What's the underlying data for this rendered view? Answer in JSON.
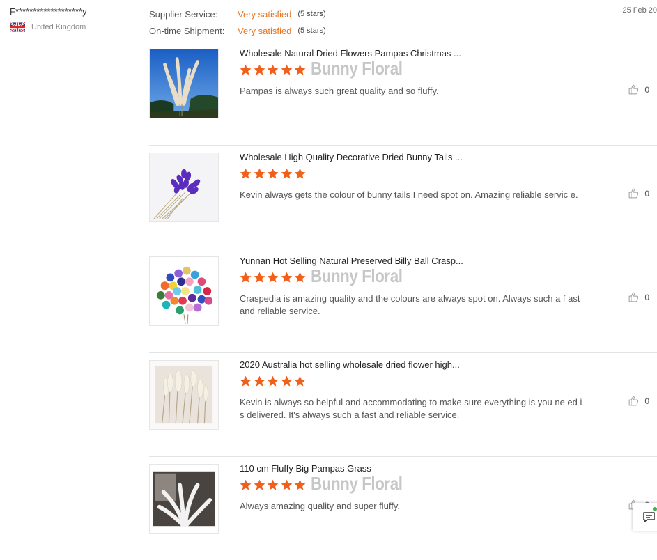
{
  "reviewer": {
    "name": "F*******************y",
    "country": "United Kingdom",
    "flag_icon": "uk-flag-icon"
  },
  "ratings": [
    {
      "label": "Supplier Service:",
      "value": "Very satisfied",
      "stars": "(5 stars)"
    },
    {
      "label": "On-time Shipment:",
      "value": "Very satisfied",
      "stars": "(5 stars)"
    }
  ],
  "date": "25 Feb 20",
  "accent_color": "#e8731d",
  "star_color": "#f0601a",
  "reviews": [
    {
      "title": "Wholesale Natural Dried Flowers Pampas Christmas ...",
      "rating": 5,
      "watermark": "Bunny Floral",
      "comment": "Pampas is always such great quality and so fluffy.",
      "likes": "0",
      "image": "pampas-blue-sky"
    },
    {
      "title": "Wholesale High Quality Decorative Dried Bunny Tails ...",
      "rating": 5,
      "watermark": "",
      "comment": "Kevin always gets the colour of bunny tails I need spot on. Amazing reliable servic e.",
      "likes": "0",
      "image": "purple-bunny-tails"
    },
    {
      "title": "Yunnan Hot Selling Natural Preserved Billy Ball Crasp...",
      "rating": 5,
      "watermark": "Bunny Floral",
      "comment": "Craspedia is amazing quality and the colours are always spot on. Always such a f ast and reliable service.",
      "likes": "0",
      "image": "colorful-billy-balls"
    },
    {
      "title": "2020 Australia hot selling wholesale dried flower high...",
      "rating": 5,
      "watermark": "",
      "comment": "Kevin is always so helpful and accommodating to make sure everything is you ne ed is delivered. It's always such a fast and reliable service.",
      "likes": "0",
      "image": "dried-grass-bundle"
    },
    {
      "title": "110 cm Fluffy Big Pampas Grass",
      "rating": 5,
      "watermark": "Bunny Floral",
      "comment": "Always amazing quality and super fluffy.",
      "likes": "0",
      "image": "fluffy-pampas-window"
    }
  ],
  "chat_icon": "chat-icon"
}
